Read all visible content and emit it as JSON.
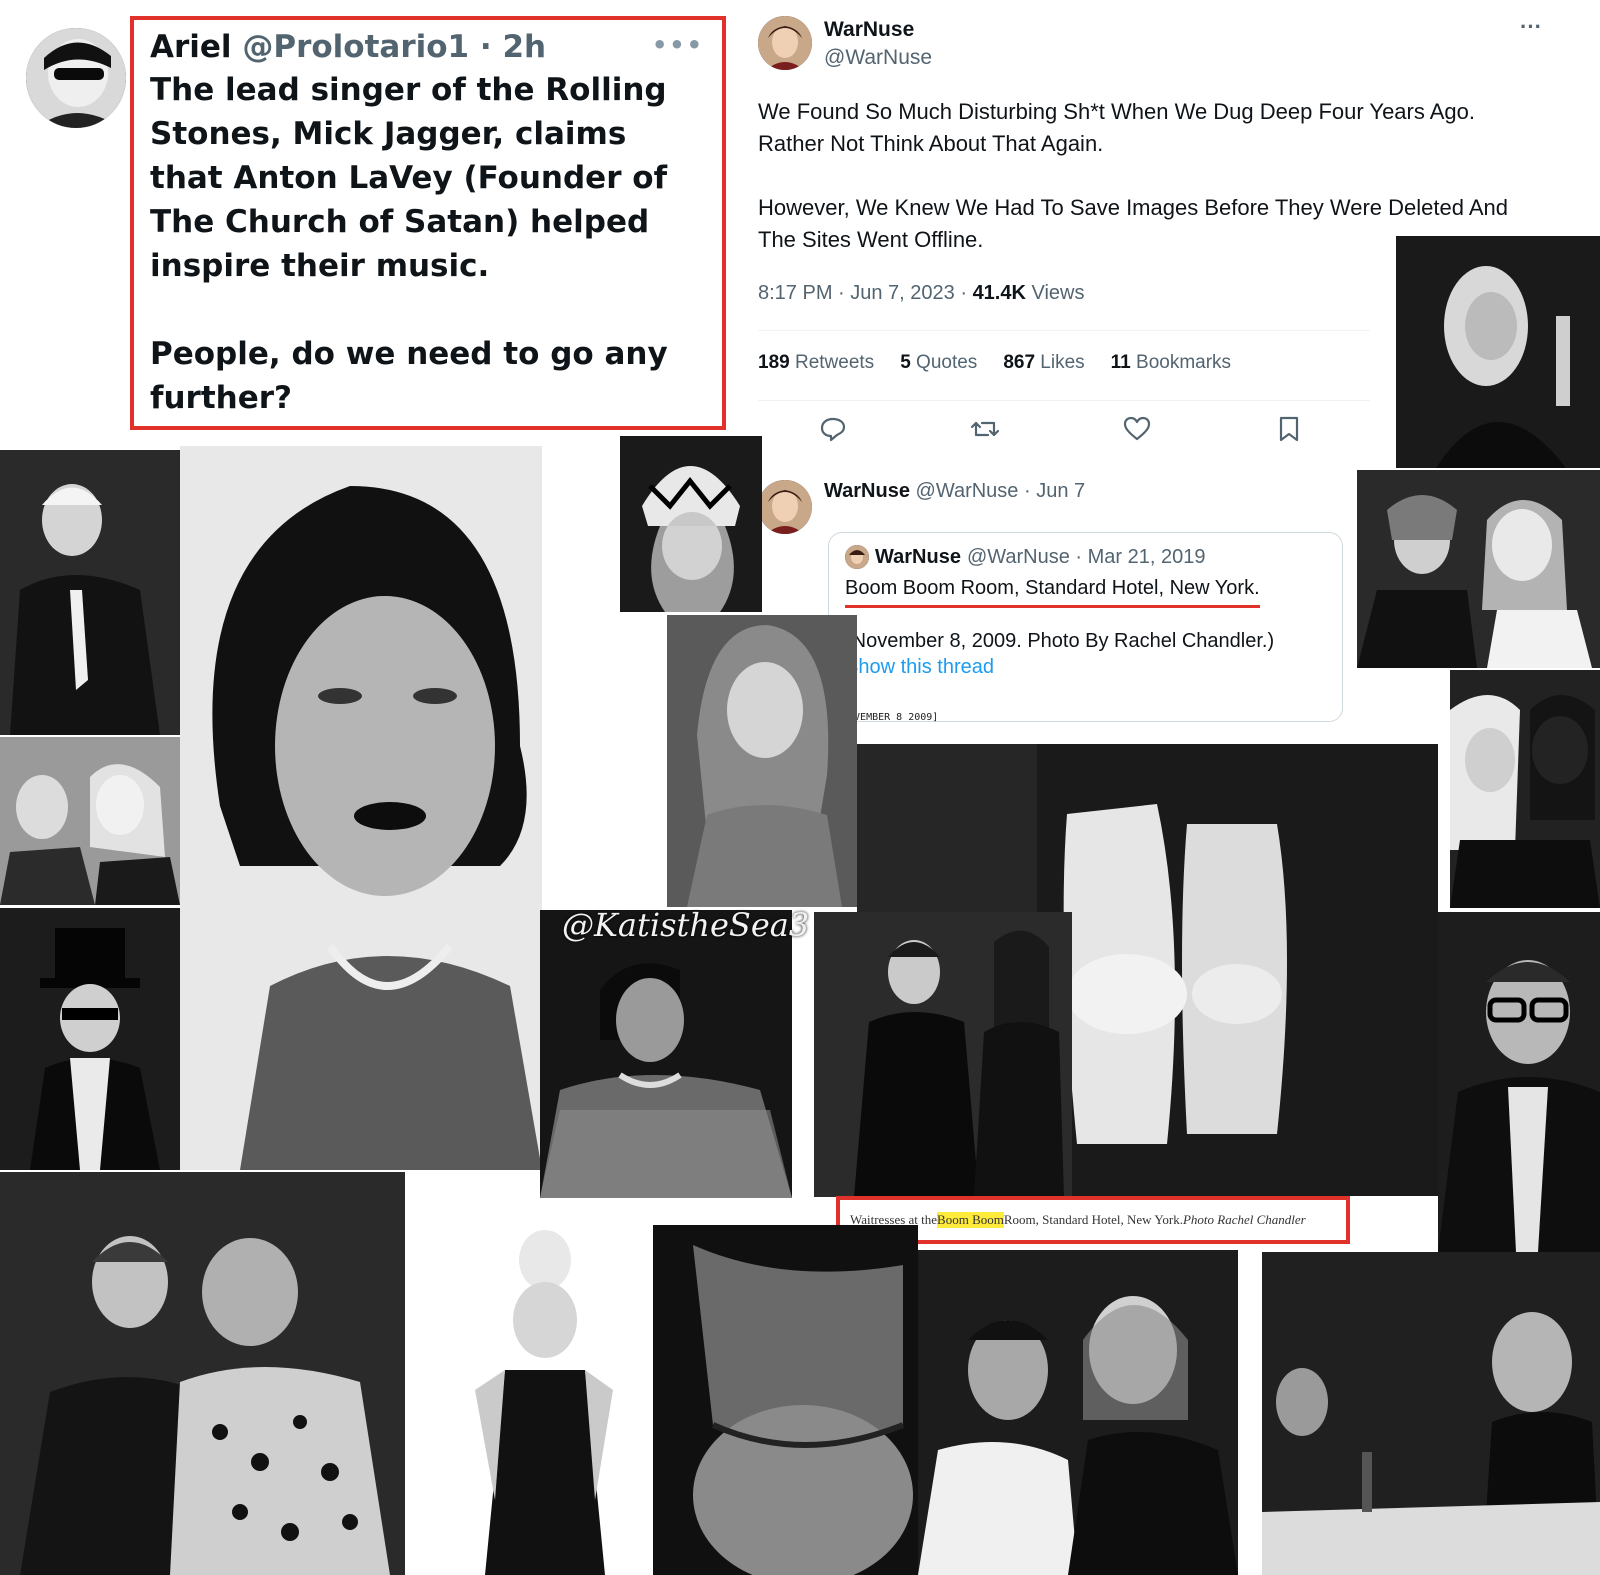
{
  "left_tweet": {
    "author_name": "Ariel",
    "author_handle": "@Prolotario1",
    "time": "· 2h",
    "more": "•••",
    "paragraph_1": "The lead singer of the Rolling Stones, Mick Jagger, claims that Anton LaVey (Founder of The Church of Satan) helped inspire their music.",
    "paragraph_2": "People, do we need to go any further?",
    "highlight_color": "#e0312a"
  },
  "right_tweet": {
    "author_name": "WarNuse",
    "author_handle": "@WarNuse",
    "more": "···",
    "paragraph_1": "We Found So Much Disturbing Sh*t When We Dug Deep Four Years Ago. Rather Not Think About That Again.",
    "paragraph_2": "However, We Knew We Had To Save Images Before They Were Deleted And The Sites Went Offline.",
    "time": "8:17 PM · Jun 7, 2023 · ",
    "views_count": "41.4K",
    "views_label": " Views",
    "stats": [
      {
        "count": "189",
        "label": "Retweets"
      },
      {
        "count": "5",
        "label": "Quotes"
      },
      {
        "count": "867",
        "label": "Likes"
      },
      {
        "count": "11",
        "label": "Bookmarks"
      }
    ],
    "actions": [
      "reply-icon",
      "retweet-icon",
      "like-icon",
      "bookmark-icon"
    ]
  },
  "reply": {
    "author_name": "WarNuse",
    "author_handle": "@WarNuse · Jun 7",
    "quote": {
      "author_name": "WarNuse",
      "author_handle": "@WarNuse · Mar 21, 2019",
      "line_1": "Boom Boom Room, Standard Hotel, New York.",
      "line_2": "(November 8, 2009. Photo By Rachel Chandler.)",
      "link": "Show this thread",
      "strip_text": "NOVEMBER 8 2009]"
    }
  },
  "caption": {
    "before": "Waitresses at the ",
    "highlight": "Boom Boom",
    "after": " Room, Standard Hotel, New York. ",
    "credit": "Photo Rachel Chandler"
  },
  "watermark": "@KatistheSea3"
}
